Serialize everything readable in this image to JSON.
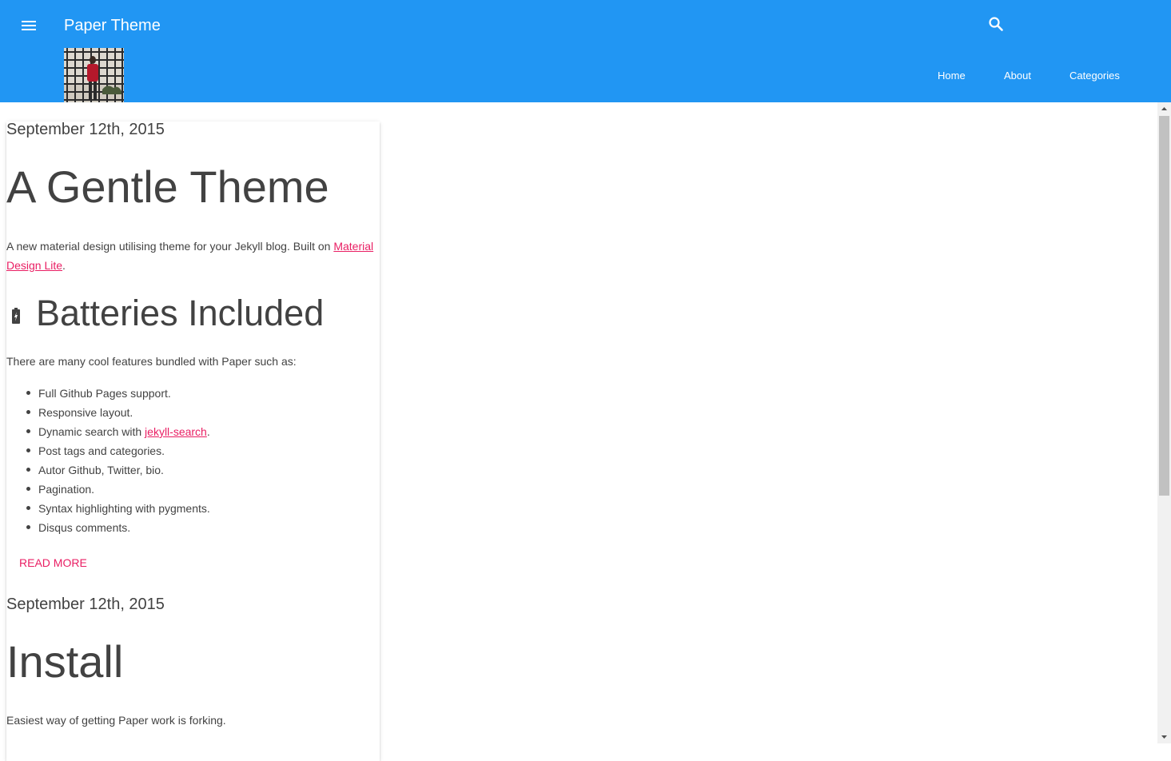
{
  "header": {
    "title": "Paper Theme",
    "menu_icon": "menu-icon",
    "search_icon": "search-icon",
    "nav": [
      "Home",
      "About",
      "Categories"
    ],
    "bg_color": "#2196f3"
  },
  "posts": [
    {
      "date": "September 12th, 2015",
      "title": "A Gentle Theme",
      "intro_text": "A new material design utilising theme for your Jekyll blog. Built on ",
      "intro_link": "Material Design Lite",
      "intro_end": ".",
      "section_icon": "battery-charging-icon",
      "section_title": "Batteries Included",
      "features_intro": "There are many cool features bundled with Paper such as:",
      "features": [
        "Full Github Pages support.",
        "Responsive layout.",
        "Dynamic search with ",
        "Post tags and categories.",
        "Autor Github, Twitter, bio.",
        "Pagination.",
        "Syntax highlighting with pygments.",
        "Disqus comments."
      ],
      "feature_link": "jekyll-search",
      "feature_link_end": ".",
      "read_more": "READ MORE"
    },
    {
      "date": "September 12th, 2015",
      "title": "Install",
      "intro_text": "Easiest way of getting Paper work is forking."
    }
  ],
  "accent_color": "#e91e63"
}
